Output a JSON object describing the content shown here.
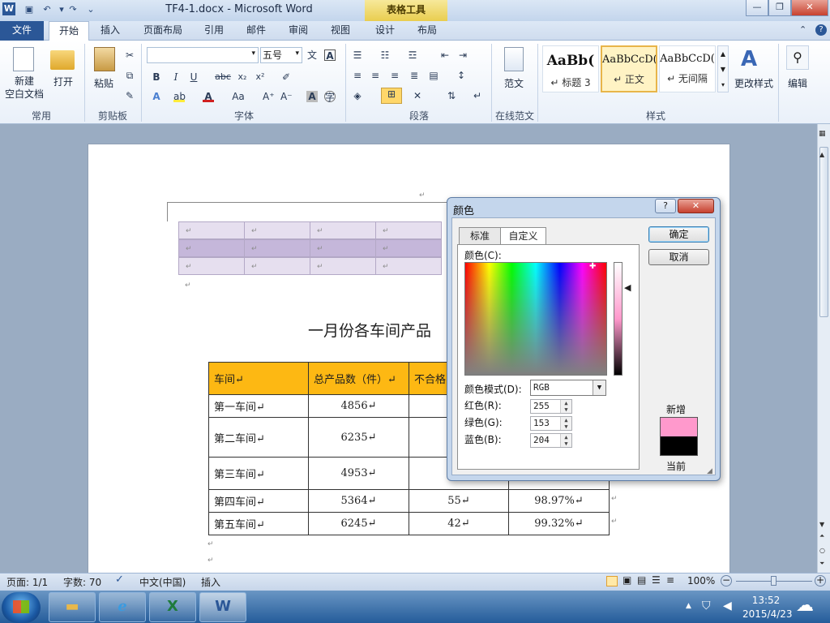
{
  "window": {
    "title": "TF4-1.docx - Microsoft Word",
    "contextual_tab_header": "表格工具",
    "app_icon": "W"
  },
  "ribbon_tabs": [
    "文件",
    "开始",
    "插入",
    "页面布局",
    "引用",
    "邮件",
    "审阅",
    "视图",
    "设计",
    "布局"
  ],
  "ribbon": {
    "common_group": {
      "label": "常用",
      "new_blank": "新建\n空白文档",
      "new_blank_line1": "新建",
      "new_blank_line2": "空白文档",
      "open": "打开"
    },
    "clipboard": {
      "label": "剪贴板",
      "paste": "粘贴"
    },
    "font": {
      "label": "字体",
      "font_name": "",
      "font_size": "五号"
    },
    "paragraph": {
      "label": "段落"
    },
    "templates": {
      "label": "在线范文",
      "button": "范文"
    },
    "styles": {
      "label": "样式",
      "items": [
        {
          "sample": "AaBb(",
          "name": "↵ 标题 3"
        },
        {
          "sample": "AaBbCcD(",
          "name": "↵ 正文"
        },
        {
          "sample": "AaBbCcD(",
          "name": "↵ 无间隔"
        }
      ],
      "change_styles": "更改样式"
    },
    "editing": {
      "label": "编辑"
    }
  },
  "document": {
    "title": "一月份各车间产品",
    "para_mark": "↵",
    "table_headers": [
      "车间↵",
      "总产品数（件）↵",
      "不合格"
    ],
    "rows": [
      {
        "name": "第一车间↵",
        "total": "4856↵",
        "defect": "",
        "rate": ""
      },
      {
        "name": "第二车间↵",
        "total": "6235↵",
        "defect": "",
        "rate": ""
      },
      {
        "name": "第三车间↵",
        "total": "4953↵",
        "defect": "",
        "rate": ""
      },
      {
        "name": "第四车间↵",
        "total": "5364↵",
        "defect": "55↵",
        "rate": "98.97%↵"
      },
      {
        "name": "第五车间↵",
        "total": "6245↵",
        "defect": "42↵",
        "rate": "99.32%↵"
      }
    ]
  },
  "dialog": {
    "title": "颜色",
    "help": "?",
    "close": "✕",
    "tabs": [
      "标准",
      "自定义"
    ],
    "colors_label": "颜色(C):",
    "mode_label": "颜色模式(D):",
    "mode_value": "RGB",
    "red_label": "红色(R):",
    "red": "255",
    "green_label": "绿色(G):",
    "green": "153",
    "blue_label": "蓝色(B):",
    "blue": "204",
    "ok": "确定",
    "cancel": "取消",
    "new_label": "新增",
    "current_label": "当前",
    "new_color": "#ff99cc",
    "current_color": "#000000"
  },
  "status_bar": {
    "page": "页面: 1/1",
    "words": "字数: 70",
    "language": "中文(中国)",
    "mode": "插入",
    "zoom": "100%"
  },
  "taskbar": {
    "time": "13:52",
    "date": "2015/4/23"
  }
}
